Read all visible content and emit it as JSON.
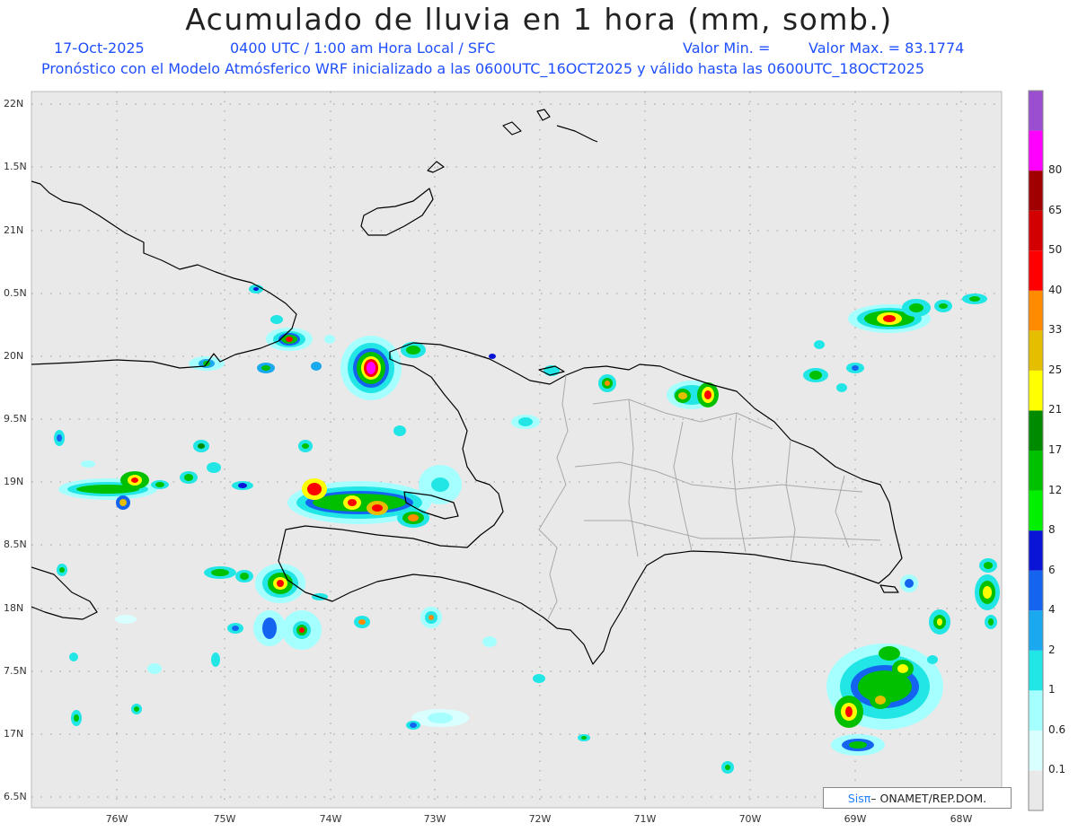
{
  "header": {
    "title": "Acumulado de lluvia en 1 hora (mm, somb.)",
    "date": "17-Oct-2025",
    "time": "0400 UTC / 1:00 am Hora Local / SFC",
    "valor_min": "Valor Min. =",
    "valor_max": "Valor Max. = 83.1774",
    "model_line": "Pronóstico con el Modelo Atmósferico WRF inicializado a las 0600UTC_16OCT2025 y válido hasta las  0600UTC_18OCT2025"
  },
  "axes": {
    "lat_labels": [
      "22N",
      "1.5N",
      "21N",
      "0.5N",
      "20N",
      "9.5N",
      "19N",
      "8.5N",
      "18N",
      "7.5N",
      "17N",
      "6.5N"
    ],
    "lon_labels": [
      "76W",
      "75W",
      "74W",
      "73W",
      "72W",
      "71W",
      "70W",
      "69W",
      "68W"
    ],
    "lat_range": [
      16.5,
      22.1
    ],
    "lon_range": [
      -76.65,
      -67.6
    ],
    "grid": "dotted"
  },
  "colorbar": {
    "labels": [
      "0.1",
      "0.6",
      "1",
      "2",
      "4",
      "6",
      "8",
      "12",
      "17",
      "21",
      "25",
      "33",
      "40",
      "50",
      "65",
      "80"
    ],
    "colors": [
      "#e9e9e9",
      "#d9ffff",
      "#a6ffff",
      "#22e6e6",
      "#1aa8ee",
      "#1464f0",
      "#0a14d6",
      "#00f000",
      "#00c000",
      "#008a00",
      "#ffff00",
      "#e6be00",
      "#ff8c00",
      "#ff0000",
      "#d20000",
      "#a00000",
      "#ff00ff",
      "#9b4fd0"
    ]
  },
  "credit": {
    "sis": "Sisπ",
    "rest": " – ONAMET/REP.DOM."
  },
  "colors": {
    "background": "#e9e9e9",
    "coast": "#000000",
    "provinces": "#a8a8a8",
    "subtitle": "#1f4fff"
  }
}
